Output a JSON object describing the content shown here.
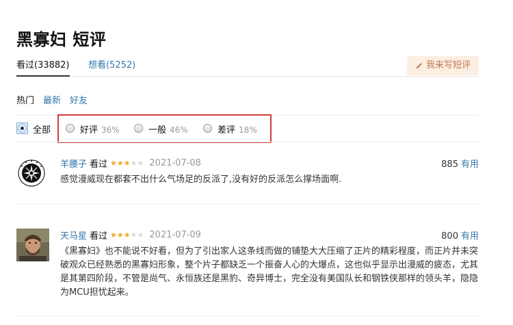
{
  "title": "黑寡妇 短评",
  "tabs": {
    "seen": "看过(33882)",
    "want": "想看(5252)"
  },
  "write_button": "我来写短评",
  "subnav": {
    "hot": "热门",
    "new": "最新",
    "friends": "好友"
  },
  "filters": {
    "all": "全部",
    "good": {
      "label": "好评",
      "pct": "36%"
    },
    "ok": {
      "label": "一般",
      "pct": "46%"
    },
    "bad": {
      "label": "差评",
      "pct": "18%"
    }
  },
  "comments": [
    {
      "user": "羊腰子",
      "status": "看过",
      "rating": 3,
      "date": "2021-07-08",
      "votes": "885",
      "useful": "有用",
      "text": "感觉漫威现在都套不出什么气场足的反派了,没有好的反派怎么撑场面啊."
    },
    {
      "user": "天马星",
      "status": "看过",
      "rating": 3,
      "date": "2021-07-09",
      "votes": "800",
      "useful": "有用",
      "text": "《黑寡妇》也不能说不好看，但为了引出家人这条线而做的铺垫大大压缩了正片的精彩程度，而正片并未突破观众已经熟悉的黑寡妇形象，整个片子都缺乏一个振奋人心的大爆点，这也似乎显示出漫威的疲态，尤其是其第四阶段，不管是尚气、永恒族还是黑豹、奇异博士，完全没有美国队长和钢铁侠那样的领头羊，隐隐为MCU担忧起来。"
    }
  ],
  "colors": {
    "link": "#3377aa",
    "star": "#f5a623",
    "highlight_box": "#d03b3b",
    "write_button_bg": "#fdeee2"
  }
}
